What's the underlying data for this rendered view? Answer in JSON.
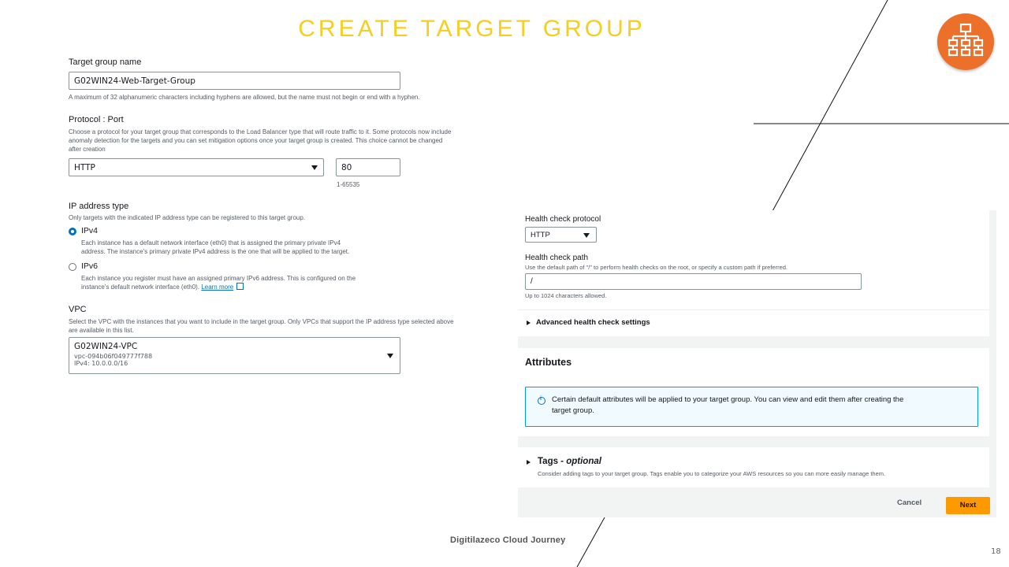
{
  "slide": {
    "title": "CREATE TARGET GROUP",
    "footer": "Digitilazeco Cloud Journey",
    "page_number": "18",
    "logo_icon": "hierarchy-icon",
    "logo_color": "#ec6f2a",
    "title_color": "#f5ce1e"
  },
  "target_group_form": {
    "name_label": "Target group name",
    "name_value": "G02WIN24-Web-Target-Group",
    "name_hint": "A maximum of 32 alphanumeric characters including hyphens are allowed, but the name must not begin or end with a hyphen.",
    "protocol_port_label": "Protocol : Port",
    "protocol_port_desc_1": "Choose a protocol for your target group that corresponds to the Load Balancer type that will route traffic to it. Some protocols now include",
    "protocol_port_desc_2": "anomaly detection for the targets and you can set mitigation options once your target group is created. This choice cannot be changed",
    "protocol_port_desc_3": "after creation",
    "protocol_value": "HTTP",
    "port_value": "80",
    "port_range": "1-65535",
    "ip_type_label": "IP address type",
    "ip_type_desc": "Only targets with the indicated IP address type can be registered to this target group.",
    "ipv4_label": "IPv4",
    "ipv4_desc_1": "Each instance has a default network interface (eth0) that is assigned the primary private IPv4",
    "ipv4_desc_2": "address. The instance's primary private IPv4 address is the one that will be applied to the target.",
    "ipv6_label": "IPv6",
    "ipv6_desc_1": "Each instance you register must have an assigned primary IPv6 address. This is configured on the",
    "ipv6_desc_2": "instance's default network interface (eth0).",
    "learn_more": "Learn more",
    "selected_ip_type": "IPv4",
    "vpc_label": "VPC",
    "vpc_desc_1": "Select the VPC with the instances that you want to include in the target group. Only VPCs that support the IP address type selected above",
    "vpc_desc_2": "are available in this list.",
    "vpc_name": "G02WIN24-VPC",
    "vpc_id": "vpc-094b06f049777f788",
    "vpc_cidr": "IPv4: 10.0.0.0/16"
  },
  "health_check": {
    "protocol_label": "Health check protocol",
    "protocol_value": "HTTP",
    "path_label": "Health check path",
    "path_desc": "Use the default path of \"/\" to perform health checks on the root, or specify a custom path if preferred.",
    "path_value": "/",
    "path_limit": "Up to 1024 characters allowed.",
    "advanced_label": "Advanced health check settings"
  },
  "attributes": {
    "title": "Attributes",
    "info_1": "Certain default attributes will be applied to your target group. You can view and edit them after creating the",
    "info_2": "target group."
  },
  "tags": {
    "title": "Tags - ",
    "optional": "optional",
    "desc": "Consider adding tags to your target group. Tags enable you to categorize your AWS resources so you can more easily manage them."
  },
  "actions": {
    "cancel": "Cancel",
    "next": "Next",
    "next_color": "#ff9900"
  }
}
